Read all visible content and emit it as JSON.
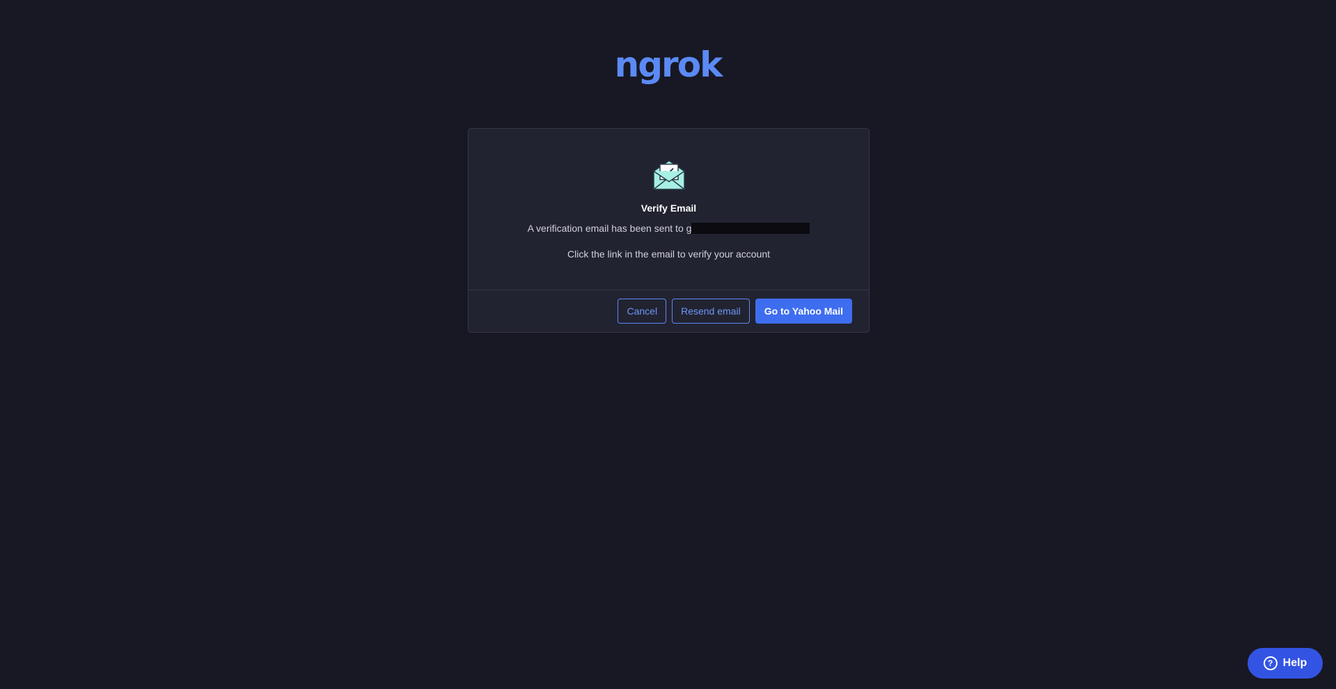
{
  "logo": {
    "text": "ngrok",
    "color": "#5b8af5"
  },
  "card": {
    "icon": "mail-open-check-icon",
    "title": "Verify Email",
    "sent_prefix": "A verification email has been sent to g",
    "instruction": "Click the link in the email to verify your account"
  },
  "buttons": {
    "cancel": "Cancel",
    "resend": "Resend email",
    "open_mail": "Go to Yahoo Mail"
  },
  "help": {
    "label": "Help",
    "icon": "question-circle-icon"
  },
  "colors": {
    "background": "#181824",
    "card": "#222331",
    "accent": "#3e6df0",
    "icon": "#a6f0e4"
  }
}
